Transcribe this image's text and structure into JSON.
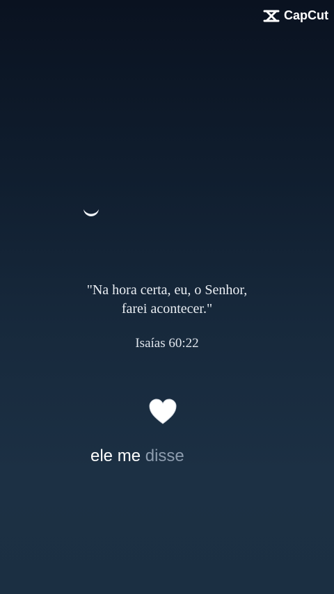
{
  "watermark": {
    "brand": "CapCut",
    "icon": "capcut-logo-icon"
  },
  "decor": {
    "moon_icon": "crescent-moon-icon",
    "heart_icon": "white-heart-icon",
    "heart_color": "#ffffff"
  },
  "verse": {
    "line1": "\"Na hora certa, eu, o Senhor,",
    "line2": "farei acontecer.\"",
    "reference": "Isaías 60:22"
  },
  "caption": {
    "highlighted": "ele me",
    "pending": "disse"
  },
  "colors": {
    "background_top": "#0a1220",
    "background_bottom": "#1c3044",
    "text": "#e9edf2",
    "caption_pending": "#8d9cae"
  }
}
